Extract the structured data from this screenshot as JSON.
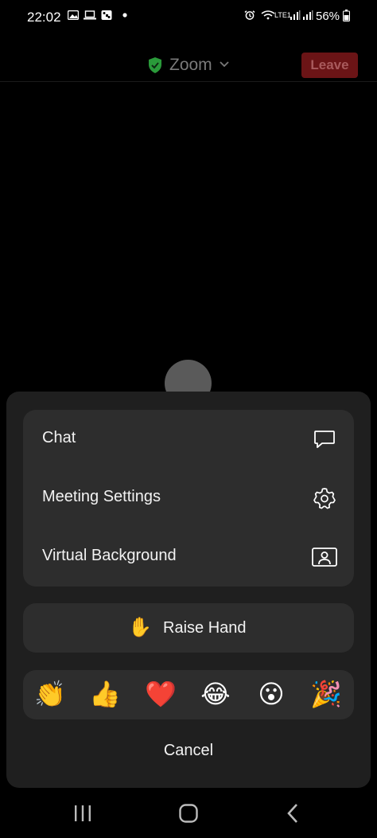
{
  "status_bar": {
    "time": "22:02",
    "battery": "56%",
    "network": "LTE1",
    "icons": [
      "image-icon",
      "laptop-icon",
      "dice-icon",
      "dot-icon",
      "alarm-icon",
      "wifi-icon",
      "signal-icon",
      "signal-icon-2",
      "battery-icon"
    ]
  },
  "header": {
    "title": "Zoom",
    "leave_label": "Leave"
  },
  "menu": {
    "items": [
      {
        "label": "Chat",
        "icon": "chat-icon"
      },
      {
        "label": "Meeting Settings",
        "icon": "gear-icon"
      },
      {
        "label": "Virtual Background",
        "icon": "virtual-background-icon"
      }
    ]
  },
  "raise_hand": {
    "emoji": "✋",
    "label": "Raise Hand"
  },
  "reactions": [
    {
      "emoji": "👏",
      "name": "clap"
    },
    {
      "emoji": "👍",
      "name": "thumbs-up"
    },
    {
      "emoji": "❤️",
      "name": "heart"
    },
    {
      "emoji": "😂",
      "name": "laugh"
    },
    {
      "emoji": "😮",
      "name": "wow"
    },
    {
      "emoji": "🎉",
      "name": "party"
    }
  ],
  "cancel_label": "Cancel",
  "colors": {
    "background": "#000000",
    "sheet": "#1f1f1f",
    "card": "#2d2d2d",
    "leave": "#6b1416",
    "shield": "#2a9a3a"
  }
}
